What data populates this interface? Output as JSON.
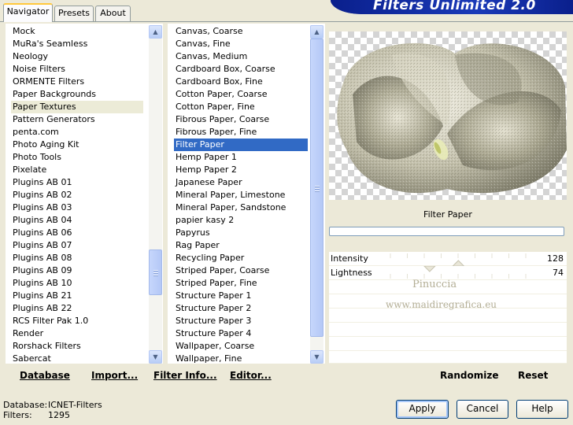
{
  "banner": {
    "title": "Filters Unlimited 2.0"
  },
  "tabs": [
    {
      "label": "Navigator",
      "active": true
    },
    {
      "label": "Presets",
      "active": false
    },
    {
      "label": "About",
      "active": false
    }
  ],
  "categories": {
    "items": [
      "Mock",
      "MuRa's Seamless",
      "Neology",
      "Noise Filters",
      "ORMENTE Filters",
      "Paper Backgrounds",
      "Paper Textures",
      "Pattern Generators",
      "penta.com",
      "Photo Aging Kit",
      "Photo Tools",
      "Pixelate",
      "Plugins AB 01",
      "Plugins AB 02",
      "Plugins AB 03",
      "Plugins AB 04",
      "Plugins AB 06",
      "Plugins AB 07",
      "Plugins AB 08",
      "Plugins AB 09",
      "Plugins AB 10",
      "Plugins AB 21",
      "Plugins AB 22",
      "RCS Filter Pak 1.0",
      "Render",
      "Rorshack Filters",
      "Sabercat"
    ],
    "selected_index": 6
  },
  "filters": {
    "items": [
      "Canvas, Coarse",
      "Canvas, Fine",
      "Canvas, Medium",
      "Cardboard Box, Coarse",
      "Cardboard Box, Fine",
      "Cotton Paper, Coarse",
      "Cotton Paper, Fine",
      "Fibrous Paper, Coarse",
      "Fibrous Paper, Fine",
      "Filter Paper",
      "Hemp Paper 1",
      "Hemp Paper 2",
      "Japanese Paper",
      "Mineral Paper, Limestone",
      "Mineral Paper, Sandstone",
      "papier kasy 2",
      "Papyrus",
      "Rag Paper",
      "Recycling Paper",
      "Striped Paper, Coarse",
      "Striped Paper, Fine",
      "Structure Paper 1",
      "Structure Paper 2",
      "Structure Paper 3",
      "Structure Paper 4",
      "Wallpaper, Coarse",
      "Wallpaper, Fine"
    ],
    "selected_index": 9
  },
  "toolbar": {
    "database": "Database",
    "import": "Import...",
    "filter_info": "Filter Info...",
    "editor": "Editor...",
    "randomize": "Randomize",
    "reset": "Reset"
  },
  "preview": {
    "filter_name": "Filter Paper",
    "watermark_line1": "Pinuccia",
    "watermark_line2": "www.maidiregrafica.eu"
  },
  "params": [
    {
      "label": "Intensity",
      "value": "128",
      "level": 0.502
    },
    {
      "label": "Lightness",
      "value": "74",
      "level": 0.29
    }
  ],
  "status": {
    "database_label": "Database:",
    "database_value": "ICNET-Filters",
    "filters_label": "Filters:",
    "filters_value": "1295"
  },
  "buttons": {
    "apply": "Apply",
    "cancel": "Cancel",
    "help": "Help"
  },
  "colors": {
    "accent": "#316ac5",
    "banner": "#0a1f8c",
    "tab_highlight": "#ffc83c"
  }
}
